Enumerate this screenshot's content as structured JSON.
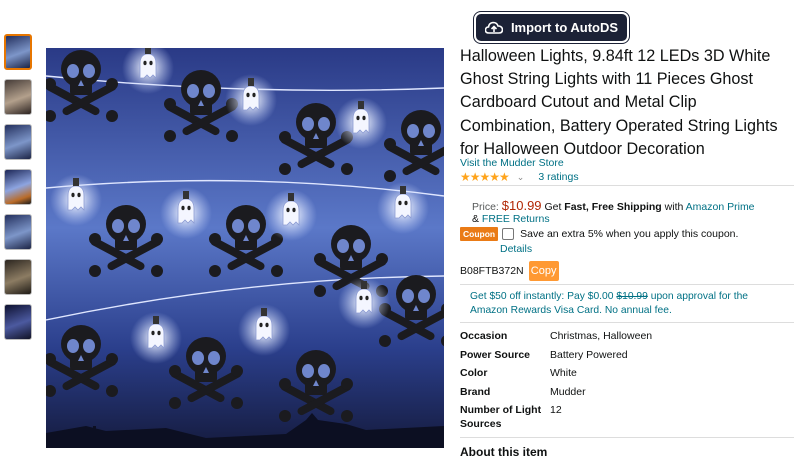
{
  "extension": {
    "import_label": "Import to AutoDS",
    "icon": "cloud-upload-icon"
  },
  "product": {
    "title": "Halloween Lights, 9.84ft 12 LEDs 3D White Ghost String Lights with 11 Pieces Ghost Cardboard Cutout and Metal Clip Combination, Battery Operated String Lights for Halloween Outdoor Decoration",
    "store_link": "Visit the Mudder Store",
    "stars": "★★★★★",
    "ratings_count": "3 ratings",
    "price_label": "Price:",
    "price": "$10.99",
    "shipping_pre": "Get ",
    "shipping_bold": "Fast, Free Shipping",
    "shipping_mid": " with ",
    "shipping_link": "Amazon Prime",
    "returns_pre": "& ",
    "returns_link": "FREE Returns",
    "coupon_badge": "Coupon",
    "coupon_text": "Save an extra 5% when you apply this coupon.",
    "details_link": "Details",
    "asin": "B08FTB372N",
    "copy_label": "Copy",
    "promo_pre": "Get $50 off instantly: Pay $0.00 ",
    "promo_strike": "$10.99",
    "promo_post": " upon approval for the Amazon Rewards Visa Card. No annual fee.",
    "specs": [
      {
        "key": "Occasion",
        "value": "Christmas, Halloween"
      },
      {
        "key": "Power Source",
        "value": "Battery Powered"
      },
      {
        "key": "Color",
        "value": "White"
      },
      {
        "key": "Brand",
        "value": "Mudder"
      },
      {
        "key": "Number of Light Sources",
        "value": "12"
      }
    ],
    "about_heading": "About this item"
  },
  "colors": {
    "price": "#b12704",
    "link": "#007185",
    "star": "#ffa41c",
    "coupon": "#ea7b16",
    "copy": "#ff9933",
    "extension_bg": "#1c2236"
  }
}
